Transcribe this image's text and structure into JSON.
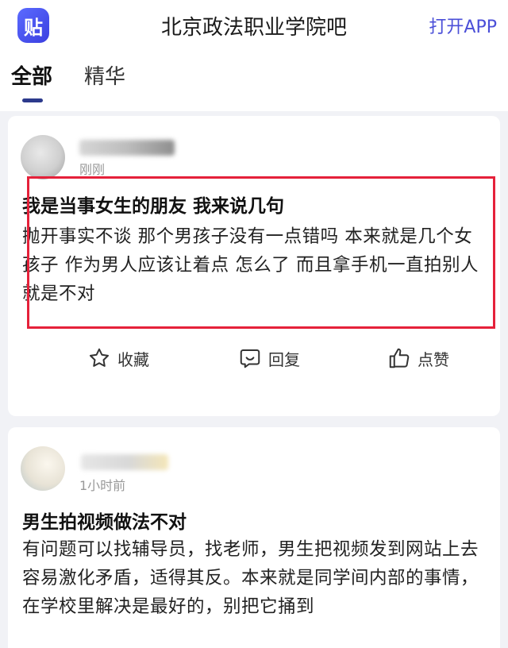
{
  "header": {
    "logo_text": "贴",
    "title": "北京政法职业学院吧",
    "open_app": "打开APP"
  },
  "tabs": [
    {
      "label": "全部",
      "active": true
    },
    {
      "label": "精华",
      "active": false
    }
  ],
  "posts": [
    {
      "time": "刚刚",
      "title": "我是当事女生的朋友 我来说几句",
      "body": "抛开事实不谈 那个男孩子没有一点错吗 本来就是几个女孩子 作为男人应该让着点 怎么了 而且拿手机一直拍别人就是不对",
      "actions": {
        "favorite": "收藏",
        "reply": "回复",
        "like": "点赞"
      }
    },
    {
      "time": "1小时前",
      "title": "男生拍视频做法不对",
      "body": "有问题可以找辅导员，找老师，男生把视频发到网站上去容易激化矛盾，适得其反。本来就是同学间内部的事情，在学校里解决是最好的，别把它捅到"
    }
  ],
  "colors": {
    "accent": "#4b4fd8",
    "highlight_border": "#e5213a"
  },
  "icons": [
    "star-icon",
    "comment-icon",
    "thumbs-up-icon"
  ]
}
